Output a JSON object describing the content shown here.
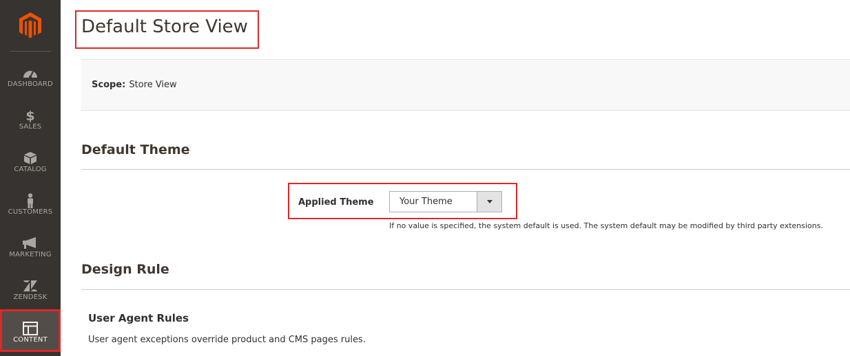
{
  "sidebar": {
    "logo_icon": "magento-logo-icon",
    "items": [
      {
        "label": "DASHBOARD",
        "icon": "dashboard-icon"
      },
      {
        "label": "SALES",
        "icon": "dollar-icon"
      },
      {
        "label": "CATALOG",
        "icon": "box-icon"
      },
      {
        "label": "CUSTOMERS",
        "icon": "person-icon"
      },
      {
        "label": "MARKETING",
        "icon": "megaphone-icon"
      },
      {
        "label": "ZENDESK",
        "icon": "zendesk-icon"
      },
      {
        "label": "CONTENT",
        "icon": "layout-icon",
        "active": true
      }
    ]
  },
  "page": {
    "title": "Default Store View"
  },
  "scope": {
    "key": "Scope:",
    "value": "Store View"
  },
  "default_theme": {
    "section_title": "Default Theme",
    "field_label": "Applied Theme",
    "selected_value": "Your Theme",
    "note": "If no value is specified, the system default is used. The system default may be modified by third party extensions."
  },
  "design_rule": {
    "section_title": "Design Rule",
    "subsection_title": "User Agent Rules",
    "subsection_desc": "User agent exceptions override product and CMS pages rules."
  },
  "colors": {
    "sidebar_bg": "#373330",
    "highlight": "#e22626",
    "brand_orange": "#eb5202"
  }
}
